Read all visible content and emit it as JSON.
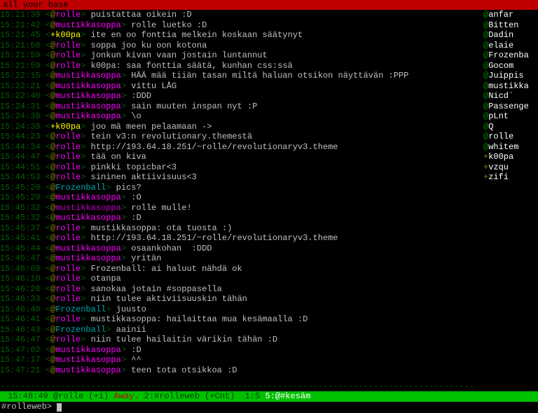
{
  "topic": "all your base",
  "nicklist": [
    {
      "prefix": "@",
      "name": "anfar"
    },
    {
      "prefix": "@",
      "name": "Bitten"
    },
    {
      "prefix": "@",
      "name": "Dadin"
    },
    {
      "prefix": "@",
      "name": "elaie"
    },
    {
      "prefix": "@",
      "name": "Frozenba"
    },
    {
      "prefix": "@",
      "name": "Gocom"
    },
    {
      "prefix": "@",
      "name": "Juippis"
    },
    {
      "prefix": "@",
      "name": "mustikka"
    },
    {
      "prefix": "@",
      "name": "Nicd`"
    },
    {
      "prefix": "@",
      "name": "Passenge"
    },
    {
      "prefix": "@",
      "name": "pLnt"
    },
    {
      "prefix": "@",
      "name": "Q"
    },
    {
      "prefix": "@",
      "name": "rolle"
    },
    {
      "prefix": "@",
      "name": "whitem"
    },
    {
      "prefix": "+",
      "name": "k00pa"
    },
    {
      "prefix": "+",
      "name": "vzqu"
    },
    {
      "prefix": "+",
      "name": "zifi"
    }
  ],
  "messages": [
    {
      "ts": "15:21:39",
      "mode": "@",
      "nick": "rolle",
      "nc": "nick-rolle",
      "msg": "puistattaa oikein :D"
    },
    {
      "ts": "15:21:42",
      "mode": "@",
      "nick": "mustikkasoppa",
      "nc": "nick-mustikka",
      "msg": "rolle luetko :D"
    },
    {
      "ts": "15:21:45",
      "mode": "+",
      "nick": "k00pa",
      "nc": "nick-k00pa",
      "msg": "ite en oo fonttia melkein koskaan säätynyt",
      "mk": true
    },
    {
      "ts": "15:21:50",
      "mode": "@",
      "nick": "rolle",
      "nc": "nick-rolle",
      "msg": "soppa joo ku oon kotona"
    },
    {
      "ts": "15:21:59",
      "mode": "@",
      "nick": "rolle",
      "nc": "nick-rolle",
      "msg": "jonkun kivan vaan jostain luntannut"
    },
    {
      "ts": "15:21:59",
      "mode": "@",
      "nick": "rolle",
      "nc": "nick-rolle",
      "msg": "k00pa: saa fonttia säätä, kunhan css:ssä"
    },
    {
      "ts": "15:22:15",
      "mode": "@",
      "nick": "mustikkasoppa",
      "nc": "nick-mustikka",
      "msg": "HÄÄ mää tiiän tasan miltä haluan otsikon näyttävän :PPP"
    },
    {
      "ts": "15:22:21",
      "mode": "@",
      "nick": "mustikkasoppa",
      "nc": "nick-mustikka",
      "msg": "vittu LÅG"
    },
    {
      "ts": "15:22:40",
      "mode": "@",
      "nick": "mustikkasoppa",
      "nc": "nick-mustikka",
      "msg": ":DDD"
    },
    {
      "ts": "15:24:31",
      "mode": "@",
      "nick": "mustikkasoppa",
      "nc": "nick-mustikka",
      "msg": "sain muuten inspan nyt :P"
    },
    {
      "ts": "15:24:38",
      "mode": "@",
      "nick": "mustikkasoppa",
      "nc": "nick-mustikka",
      "msg": "\\o"
    },
    {
      "ts": "15:24:39",
      "mode": "+",
      "nick": "k00pa",
      "nc": "nick-k00pa",
      "msg": "joo mä meen pelaamaan ->",
      "mk": true
    },
    {
      "ts": "15:44:23",
      "mode": "@",
      "nick": "rolle",
      "nc": "nick-rolle",
      "msg": "tein v3:n revolutionary.themestä"
    },
    {
      "ts": "15:44:34",
      "mode": "@",
      "nick": "rolle",
      "nc": "nick-rolle",
      "msg": "http://193.64.18.251/~rolle/revolutionaryv3.theme"
    },
    {
      "ts": "15:44:47",
      "mode": "@",
      "nick": "rolle",
      "nc": "nick-rolle",
      "msg": "tää on kiva"
    },
    {
      "ts": "15:44:51",
      "mode": "@",
      "nick": "rolle",
      "nc": "nick-rolle",
      "msg": "pinkki topicbar<3"
    },
    {
      "ts": "15:44:53",
      "mode": "@",
      "nick": "rolle",
      "nc": "nick-rolle",
      "msg": "sininen aktiivisuus<3"
    },
    {
      "ts": "15:45:20",
      "mode": "@",
      "nick": "Frozenball",
      "nc": "nick-frozen",
      "msg": "pics?"
    },
    {
      "ts": "15:45:29",
      "mode": "@",
      "nick": "mustikkasoppa",
      "nc": "nick-mustikka",
      "msg": ":O"
    },
    {
      "ts": "15:45:32",
      "mode": "@",
      "nick": "mustikkasoppa",
      "nc": "nick-mustikka-alt",
      "msg": "rolle mulle!"
    },
    {
      "ts": "15:45:32",
      "mode": "@",
      "nick": "mustikkasoppa",
      "nc": "nick-mustikka",
      "msg": ":D"
    },
    {
      "ts": "15:45:37",
      "mode": "@",
      "nick": "rolle",
      "nc": "nick-rolle",
      "msg": "mustikkasoppa: ota tuosta :)"
    },
    {
      "ts": "15:45:41",
      "mode": "@",
      "nick": "rolle",
      "nc": "nick-rolle",
      "msg": "http://193.64.18.251/~rolle/revolutionaryv3.theme"
    },
    {
      "ts": "15:45:44",
      "mode": "@",
      "nick": "mustikkasoppa",
      "nc": "nick-mustikka",
      "msg": "osaankohan  :DDD"
    },
    {
      "ts": "15:45:47",
      "mode": "@",
      "nick": "mustikkasoppa",
      "nc": "nick-mustikka",
      "msg": "yritän"
    },
    {
      "ts": "15:46:09",
      "mode": "@",
      "nick": "rolle",
      "nc": "nick-rolle",
      "msg": "Frozenball: ai haluut nähdä ok"
    },
    {
      "ts": "15:46:10",
      "mode": "@",
      "nick": "rolle",
      "nc": "nick-rolle",
      "msg": "otanpa"
    },
    {
      "ts": "15:46:28",
      "mode": "@",
      "nick": "rolle",
      "nc": "nick-rolle",
      "msg": "sanokaa jotain #soppasella"
    },
    {
      "ts": "15:46:33",
      "mode": "@",
      "nick": "rolle",
      "nc": "nick-rolle",
      "msg": "niin tulee aktiviisuuskin tähän"
    },
    {
      "ts": "15:46:40",
      "mode": "@",
      "nick": "Frozenball",
      "nc": "nick-frozen",
      "msg": "juusto"
    },
    {
      "ts": "15:46:41",
      "mode": "@",
      "nick": "rolle",
      "nc": "nick-rolle",
      "msg": "mustikkasoppa: hailaittaa mua kesämaalla :D"
    },
    {
      "ts": "15:46:43",
      "mode": "@",
      "nick": "Frozenball",
      "nc": "nick-frozen",
      "msg": "aainii"
    },
    {
      "ts": "15:46:47",
      "mode": "@",
      "nick": "rolle",
      "nc": "nick-rolle",
      "msg": "niin tulee hailaitin värikin tähän :D"
    },
    {
      "ts": "15:47:02",
      "mode": "@",
      "nick": "mustikkasoppa",
      "nc": "nick-mustikka",
      "msg": ":D"
    },
    {
      "ts": "15:47:17",
      "mode": "@",
      "nick": "mustikkasoppa",
      "nc": "nick-mustikka",
      "msg": "^^"
    },
    {
      "ts": "15:47:21",
      "mode": "@",
      "nick": "mustikkasoppa",
      "nc": "nick-mustikka",
      "msg": "teen tota otsikkoa :D"
    }
  ],
  "separator": "----------------------------------------------------------------------------------------------",
  "status": {
    "time": "15:48:49",
    "nick": "@rolle (+i)",
    "away": "Away.",
    "win2": "2:#rolleweb (+Cnt)  1:S",
    "win5": "5:@#kesäm"
  },
  "input": {
    "prompt": "#rolleweb>"
  }
}
